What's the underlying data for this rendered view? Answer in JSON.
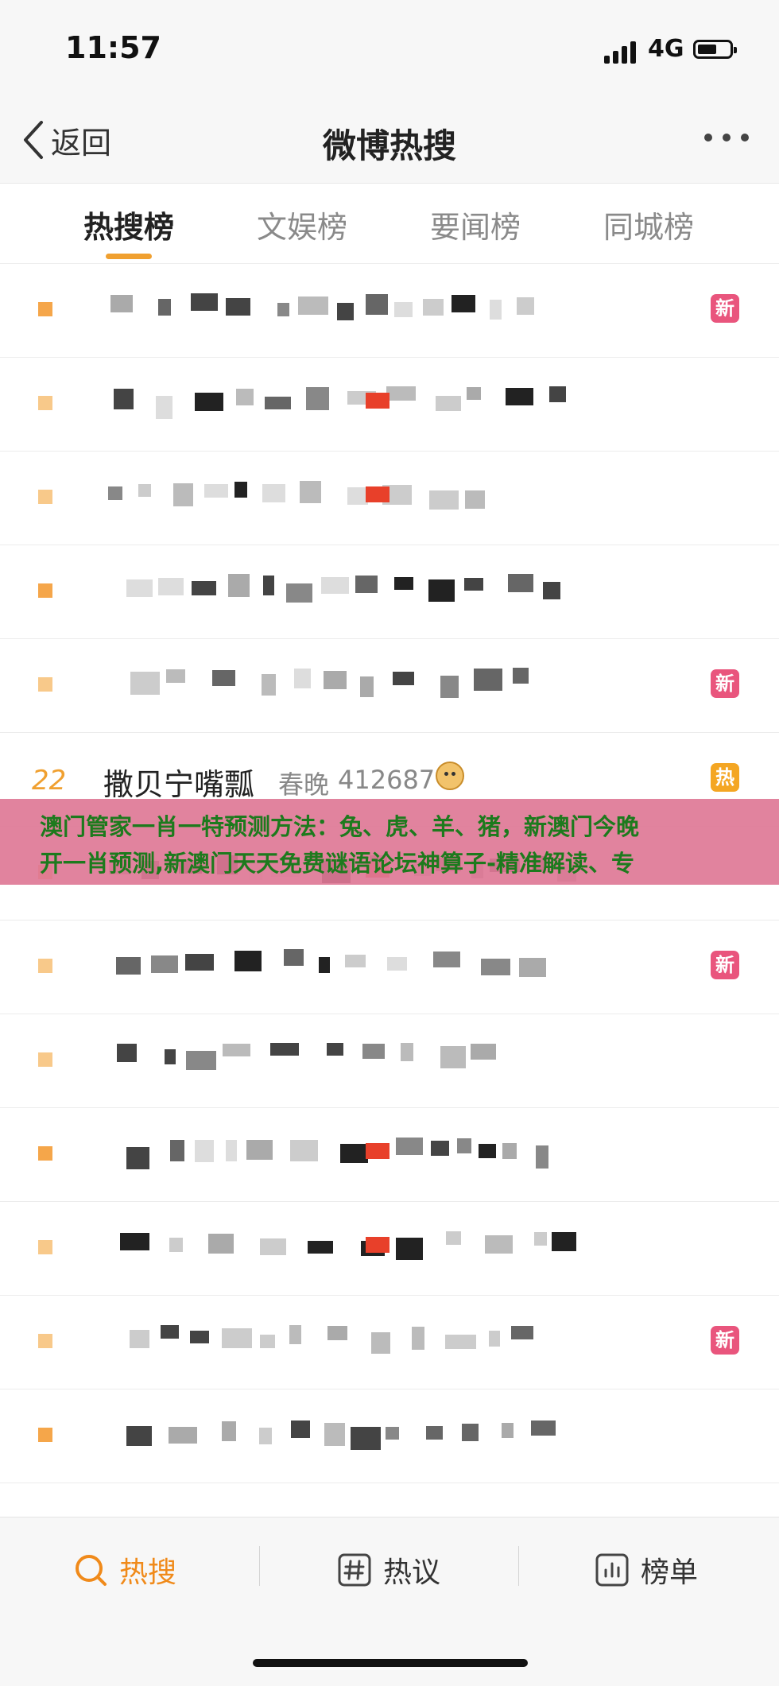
{
  "status_bar": {
    "time": "11:57",
    "network": "4G",
    "battery_level": 0.6
  },
  "nav": {
    "back_label": "返回",
    "title": "微博热搜"
  },
  "tabs": [
    {
      "label": "热搜榜",
      "active": true
    },
    {
      "label": "文娱榜",
      "active": false
    },
    {
      "label": "要闻榜",
      "active": false
    },
    {
      "label": "同城榜",
      "active": false
    }
  ],
  "rows": [
    {
      "rank": "",
      "badge": "新"
    },
    {
      "rank": "",
      "badge": ""
    },
    {
      "rank": "",
      "badge": ""
    },
    {
      "rank": "",
      "badge": ""
    },
    {
      "rank": "",
      "badge": "新"
    },
    {
      "rank": "22",
      "title": "撒贝宁嘴瓢",
      "tag": "春晚",
      "count": "412687",
      "icon": "doge-emoji-icon",
      "badge": "热"
    },
    {
      "rank": "",
      "badge": ""
    },
    {
      "rank": "",
      "badge": "新"
    },
    {
      "rank": "",
      "badge": ""
    },
    {
      "rank": "",
      "badge": ""
    },
    {
      "rank": "",
      "badge": ""
    },
    {
      "rank": "",
      "badge": "新"
    },
    {
      "rank": "",
      "badge": ""
    }
  ],
  "overlay": {
    "line1": "澳门管家一肖一特预测方法：兔、虎、羊、猪，新澳门今晚",
    "line2": "开一肖预测,新澳门天天免费谜语论坛神算子-精准解读、专"
  },
  "bottom_nav": [
    {
      "label": "热搜",
      "icon": "search-icon",
      "active": true
    },
    {
      "label": "热议",
      "icon": "hashtag-icon",
      "active": false
    },
    {
      "label": "榜单",
      "icon": "chart-icon",
      "active": false
    }
  ],
  "colors": {
    "accent": "#f08a1a",
    "new_badge": "#e9557d",
    "hot_badge": "#f4a623",
    "overlay_text": "#1d7a1d"
  }
}
